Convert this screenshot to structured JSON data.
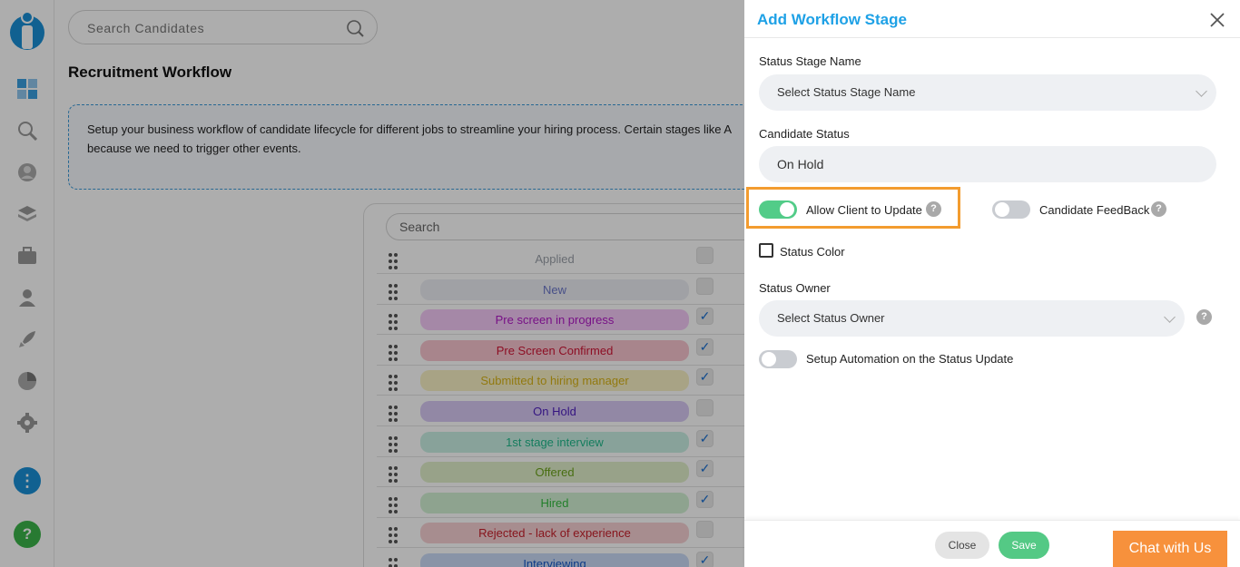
{
  "top_search": {
    "placeholder": "Search Candidates"
  },
  "page": {
    "title": "Recruitment Workflow",
    "info_line1": "Setup your business workflow of candidate lifecycle for different jobs to streamline your hiring process. Certain stages like A",
    "info_line2": "because we need to trigger other events."
  },
  "stage_list": {
    "search_placeholder": "Search",
    "stages": [
      {
        "label": "Applied",
        "color": "#9aa0a8",
        "bg": "#ffffff",
        "checked": false
      },
      {
        "label": "New",
        "color": "#6a76c9",
        "bg": "#eceef3",
        "checked": false
      },
      {
        "label": "Pre screen in progress",
        "color": "#b018c6",
        "bg": "#f4c9f6",
        "checked": true
      },
      {
        "label": "Pre Screen Confirmed",
        "color": "#d01536",
        "bg": "#f8c5cf",
        "checked": true
      },
      {
        "label": "Submitted to hiring manager",
        "color": "#d7b317",
        "bg": "#f8f1c4",
        "checked": true
      },
      {
        "label": "On Hold",
        "color": "#4e1fbe",
        "bg": "#d7c9f4",
        "checked": false
      },
      {
        "label": "1st stage interview",
        "color": "#1fb88b",
        "bg": "#c9efe3",
        "checked": true
      },
      {
        "label": "Offered",
        "color": "#6ba21a",
        "bg": "#e0efcb",
        "checked": true
      },
      {
        "label": "Hired",
        "color": "#33bb3f",
        "bg": "#d1f1d3",
        "checked": true
      },
      {
        "label": "Rejected - lack of experience",
        "color": "#c7202b",
        "bg": "#f6d0d3",
        "checked": false
      },
      {
        "label": "Interviewing",
        "color": "#1457c8",
        "bg": "#cbdaf6",
        "checked": true
      }
    ]
  },
  "drawer": {
    "title": "Add Workflow Stage",
    "stage_name_label": "Status Stage Name",
    "stage_name_placeholder": "Select Status Stage Name",
    "candidate_status_label": "Candidate Status",
    "candidate_status_value": "On Hold",
    "allow_client_label": "Allow Client to Update",
    "allow_client_on": true,
    "candidate_feedback_label": "Candidate FeedBack",
    "candidate_feedback_on": false,
    "status_color_label": "Status Color",
    "status_owner_label": "Status Owner",
    "status_owner_placeholder": "Select Status Owner",
    "automation_label": "Setup Automation on the Status Update",
    "automation_on": false,
    "help_mark": "?",
    "close_label": "Close",
    "save_label": "Save"
  },
  "chat_label": "Chat with Us",
  "sidebar": {
    "icons": [
      "dashboard-icon",
      "search-icon",
      "user-icon",
      "layers-icon",
      "briefcase-icon",
      "people-icon",
      "rocket-icon",
      "pie-chart-icon",
      "settings-icon"
    ],
    "more_label": "⋮",
    "help_label": "?"
  }
}
